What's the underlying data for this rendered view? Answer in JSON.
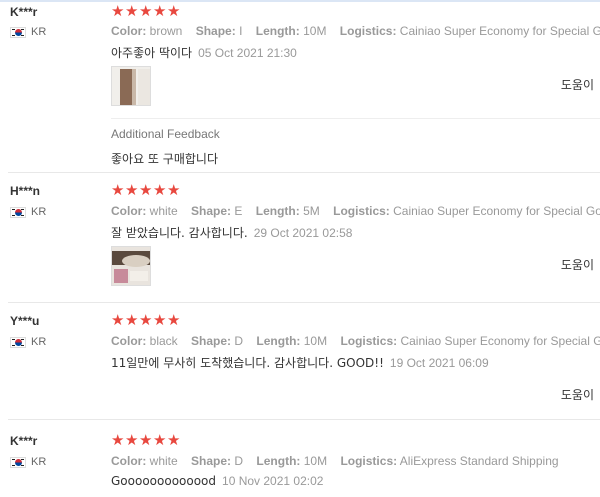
{
  "reviews": [
    {
      "user": "K***r",
      "country": "KR",
      "stars": 5,
      "attributes": [
        {
          "label": "Color:",
          "value": "brown"
        },
        {
          "label": "Shape:",
          "value": "I"
        },
        {
          "label": "Length:",
          "value": "10M"
        },
        {
          "label": "Logistics:",
          "value": "Cainiao Super Economy for Special Goods"
        }
      ],
      "text": "아주좋아 딱이다",
      "date": "05 Oct 2021 21:30",
      "helpful": "도움이",
      "additional_label": "Additional Feedback",
      "additional_text": "좋아요 또 구매합니다"
    },
    {
      "user": "H***n",
      "country": "KR",
      "stars": 5,
      "attributes": [
        {
          "label": "Color:",
          "value": "white"
        },
        {
          "label": "Shape:",
          "value": "E"
        },
        {
          "label": "Length:",
          "value": "5M"
        },
        {
          "label": "Logistics:",
          "value": "Cainiao Super Economy for Special Goods"
        }
      ],
      "text": "잘 받았습니다. 감사합니다.",
      "date": "29 Oct 2021 02:58",
      "helpful": "도움이"
    },
    {
      "user": "Y***u",
      "country": "KR",
      "stars": 5,
      "attributes": [
        {
          "label": "Color:",
          "value": "black"
        },
        {
          "label": "Shape:",
          "value": "D"
        },
        {
          "label": "Length:",
          "value": "10M"
        },
        {
          "label": "Logistics:",
          "value": "Cainiao Super Economy for Special Goods"
        }
      ],
      "text": "11일만에 무사히 도착했습니다. 감사합니다. GOOD!!",
      "date": "19 Oct 2021 06:09",
      "helpful": "도움이"
    },
    {
      "user": "K***r",
      "country": "KR",
      "stars": 5,
      "attributes": [
        {
          "label": "Color:",
          "value": "white"
        },
        {
          "label": "Shape:",
          "value": "D"
        },
        {
          "label": "Length:",
          "value": "10M"
        },
        {
          "label": "Logistics:",
          "value": "AliExpress Standard Shipping"
        }
      ],
      "text": "Gooooooooooood",
      "date": "10 Nov 2021 02:02"
    }
  ],
  "colors": {
    "star": "#e8483f",
    "muted": "#999999",
    "divider": "#e8e8e8"
  },
  "icons": {
    "flag": "south-korea-flag-icon",
    "star": "star-icon",
    "thumbnail": "review-photo-thumbnail"
  }
}
